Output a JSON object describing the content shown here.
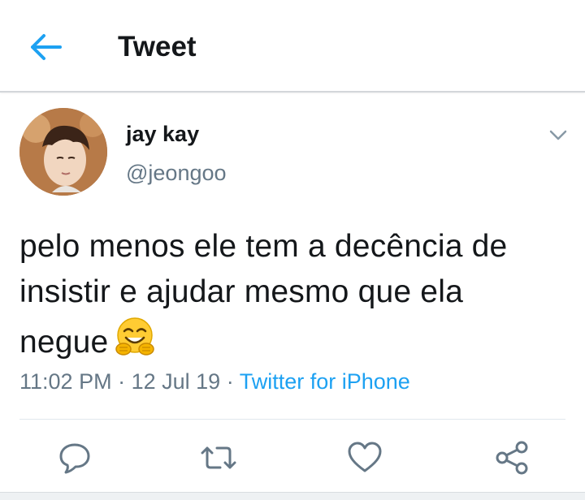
{
  "header": {
    "title": "Tweet",
    "back_icon": "arrow-left-icon",
    "accent_color": "#1da1f2"
  },
  "tweet": {
    "display_name": "jay kay",
    "handle": "@jeongoo",
    "text_lines": [
      "pelo menos ele tem a decência de",
      "insistir e ajudar mesmo que ela",
      "negue"
    ],
    "emoji": "hugging-face-icon",
    "time": "11:02 PM",
    "separator": "·",
    "date": "12 Jul 19",
    "source": "Twitter for iPhone"
  },
  "actions": {
    "icons": [
      "reply-icon",
      "retweet-icon",
      "like-icon",
      "share-icon"
    ]
  },
  "colors": {
    "text_primary": "#14171a",
    "text_secondary": "#657786",
    "link": "#1da1f2",
    "divider": "#e1e8ed"
  }
}
